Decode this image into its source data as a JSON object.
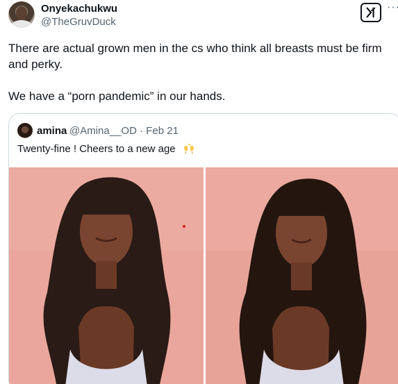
{
  "tweet": {
    "author_name": "Onyekachukwu",
    "author_handle": "@TheGruvDuck",
    "text": "There are actual grown men in the cs who think all breasts must be firm and perky.\n\nWe have a “porn pandemic” in our hands.",
    "more_glyph": "···",
    "grok_icon": "grok-icon"
  },
  "quote": {
    "author_name": "amina",
    "meta": "@Amina__OD · Feb 21",
    "text": "Twenty-fine ! Cheers to a new age",
    "emoji_icon": "clinking-glasses-icon"
  },
  "colors": {
    "text_primary": "#0f1419",
    "text_secondary": "#536471",
    "border": "#cfd9de",
    "photo_background": "#e9a49a"
  }
}
